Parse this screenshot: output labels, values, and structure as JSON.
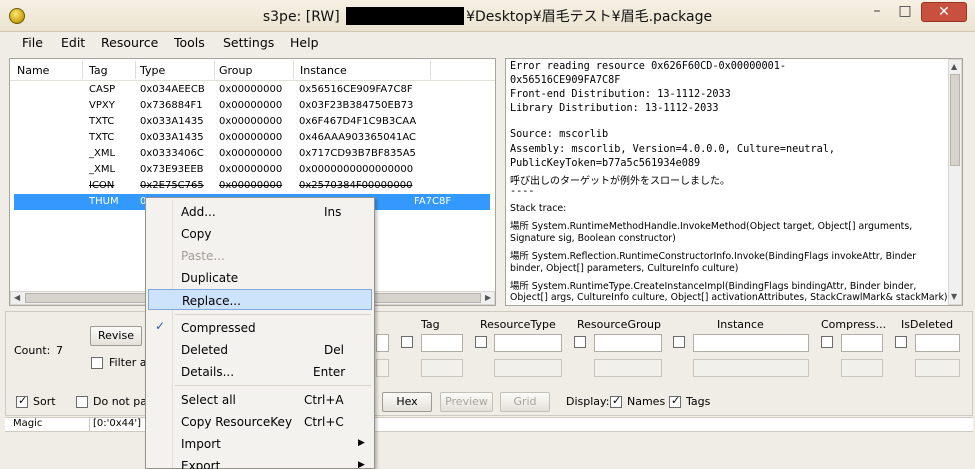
{
  "window": {
    "title_prefix": "s3pe: [RW]",
    "title_suffix": "¥Desktop¥眉毛テスト¥眉毛.package",
    "minimize": "–",
    "maximize": "□",
    "close": "✕"
  },
  "menu": [
    "File",
    "Edit",
    "Resource",
    "Tools",
    "Settings",
    "Help"
  ],
  "list": {
    "headers": [
      "Name",
      "Tag",
      "Type",
      "Group",
      "Instance"
    ],
    "rows": [
      {
        "tag": "CASP",
        "type": "0x034AEECB",
        "group": "0x00000000",
        "instance": "0x56516CE909FA7C8F"
      },
      {
        "tag": "VPXY",
        "type": "0x736884F1",
        "group": "0x00000000",
        "instance": "0x03F23B384750EB73"
      },
      {
        "tag": "TXTC",
        "type": "0x033A1435",
        "group": "0x00000000",
        "instance": "0x6F467D4F1C9B3CAA"
      },
      {
        "tag": "TXTC",
        "type": "0x033A1435",
        "group": "0x00000000",
        "instance": "0x46AAA903365041AC"
      },
      {
        "tag": "_XML",
        "type": "0x0333406C",
        "group": "0x00000000",
        "instance": "0x717CD93B7BF835A5"
      },
      {
        "tag": "_XML",
        "type": "0x73E93EEB",
        "group": "0x00000000",
        "instance": "0x0000000000000000"
      },
      {
        "tag": "ICON",
        "type": "0x2E75C765",
        "group": "0x00000000",
        "instance": "0x2570384F00000000"
      },
      {
        "tag": "THUM",
        "type": "0x",
        "group": "",
        "instance": "FA7C8F"
      }
    ]
  },
  "text_pane": {
    "mono_lines": [
      "Error reading resource 0x626F60CD-0x00000001-",
      "0x56516CE909FA7C8F",
      "Front-end Distribution: 13-1112-2033",
      "Library Distribution: 13-1112-2033",
      "",
      "Source: mscorlib",
      "Assembly: mscorlib, Version=4.0.0.0, Culture=neutral,",
      "PublicKeyToken=b77a5c561934e089"
    ],
    "jp_line": "呼び出しのターゲットが例外をスローしました。",
    "dash_line": "----",
    "trace_lines": [
      "Stack trace:",
      "  場所 System.RuntimeMethodHandle.InvokeMethod(Object target, Object[] arguments,",
      "Signature sig, Boolean constructor)",
      "  場所 System.Reflection.RuntimeConstructorInfo.Invoke(BindingFlags invokeAttr, Binder",
      "binder, Object[] parameters, CultureInfo culture)",
      "  場所 System.RuntimeType.CreateInstanceImpl(BindingFlags bindingAttr, Binder binder,",
      "Object[] args, CultureInfo culture, Object[] activationAttributes, StackCrawlMark& stackMark)"
    ]
  },
  "bottom": {
    "count_label": "Count:",
    "count_value": "7",
    "revise": "Revise",
    "filter_label": "Filter a",
    "sort_label": "Sort",
    "do_not_label": "Do not par",
    "filter_headers": [
      "Tag",
      "ResourceType",
      "ResourceGroup",
      "Instance",
      "Compress...",
      "IsDeleted"
    ],
    "hex": "Hex",
    "preview": "Preview",
    "grid": "Grid",
    "display_label": "Display:",
    "names_label": "Names",
    "tags_label": "Tags",
    "magic_label": "Magic",
    "magic_value": "[0:'0x44'] ["
  },
  "context_menu": {
    "items": [
      {
        "label": "Add...",
        "shortcut": "Ins"
      },
      {
        "label": "Copy",
        "shortcut": ""
      },
      {
        "label": "Paste...",
        "shortcut": ""
      },
      {
        "label": "Duplicate",
        "shortcut": ""
      },
      {
        "label": "Replace...",
        "shortcut": ""
      },
      {
        "label": "Compressed",
        "shortcut": ""
      },
      {
        "label": "Deleted",
        "shortcut": "Del"
      },
      {
        "label": "Details...",
        "shortcut": "Enter"
      },
      {
        "label": "Select all",
        "shortcut": "Ctrl+A"
      },
      {
        "label": "Copy ResourceKey",
        "shortcut": "Ctrl+C"
      },
      {
        "label": "Import",
        "shortcut": ""
      },
      {
        "label": "Export",
        "shortcut": ""
      }
    ],
    "check_mark": "✓",
    "submenu_arrow": "▶"
  },
  "colors": {
    "selection": "#3399ff",
    "menu_highlight": "#cde3fb",
    "close_button": "#c7503f"
  }
}
